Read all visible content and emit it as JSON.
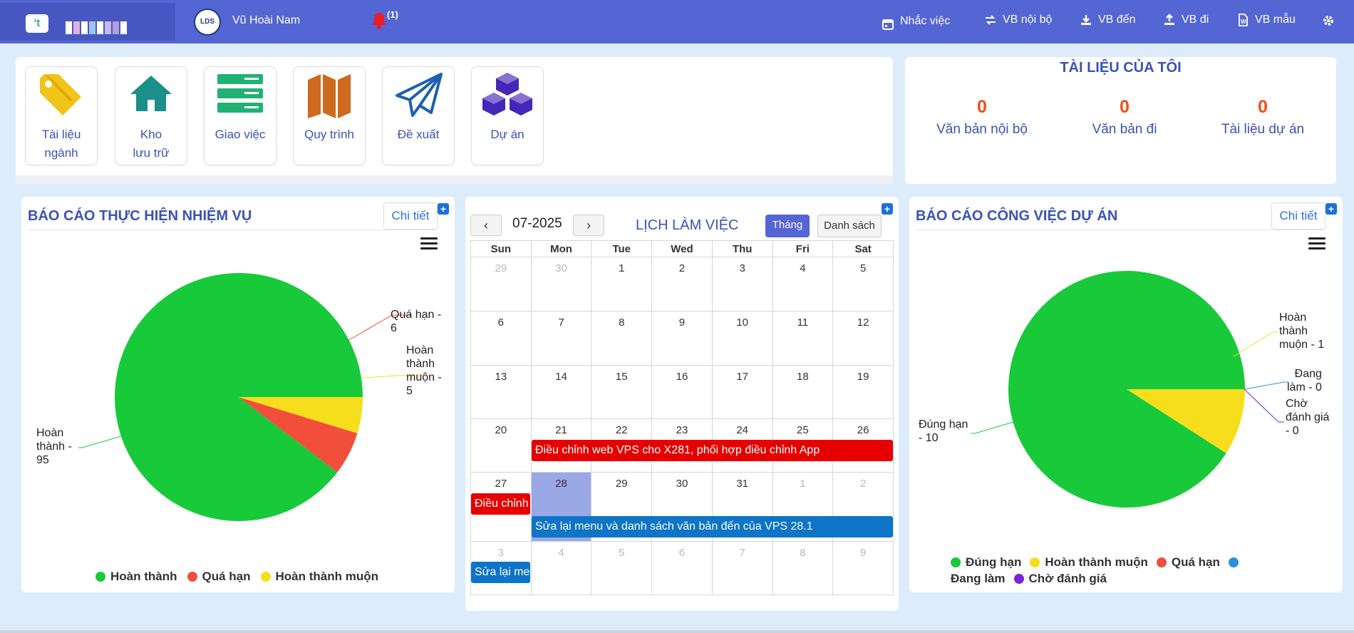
{
  "header": {
    "username": "Vũ Hoài Nam",
    "notification_count": "(1)",
    "nav": [
      {
        "label": "Nhắc việc",
        "icon": "calendar-icon"
      },
      {
        "label": "VB nội bộ",
        "icon": "exchange-icon"
      },
      {
        "label": "VB đến",
        "icon": "download-icon"
      },
      {
        "label": "VB đi",
        "icon": "upload-icon"
      },
      {
        "label": "VB mẫu",
        "icon": "word-file-icon"
      }
    ]
  },
  "tiles": [
    {
      "label": "Tài liệu\nngành",
      "icon": "tag-icon",
      "color": "#f0c419"
    },
    {
      "label": "Kho\nlưu trữ",
      "icon": "home-icon",
      "color": "#1b8f8a"
    },
    {
      "label": "Giao việc",
      "icon": "server-list-icon",
      "color": "#20b173"
    },
    {
      "label": "Quy trình",
      "icon": "map-icon",
      "color": "#cd6a1f"
    },
    {
      "label": "Đề xuất",
      "icon": "paper-plane-icon",
      "color": "#1e5fb0"
    },
    {
      "label": "Dự án",
      "icon": "cubes-icon",
      "color": "#4427b8"
    }
  ],
  "my_documents": {
    "title": "TÀI LIỆU CỦA TÔI",
    "stats": [
      {
        "count": "0",
        "label": "Văn bản nội bộ"
      },
      {
        "count": "0",
        "label": "Văn bản đi"
      },
      {
        "count": "0",
        "label": "Tài liệu dự án"
      }
    ]
  },
  "task_report": {
    "title": "BÁO CÁO THỰC HIỆN NHIỆM VỤ",
    "detail_label": "Chi tiết",
    "slice_labels": [
      "Quá hạn -\n6",
      "Hoàn\nthành\nmuộn -\n5",
      "Hoàn\nthành -\n95"
    ],
    "legend": [
      "Hoàn thành",
      "Quá hạn",
      "Hoàn thành muộn"
    ]
  },
  "calendar": {
    "title": "LỊCH LÀM VIỆC",
    "month_label": "07-2025",
    "prev": "‹",
    "next": "›",
    "view_month": "Tháng",
    "view_list": "Danh sách",
    "weekdays": [
      "Sun",
      "Mon",
      "Tue",
      "Wed",
      "Thu",
      "Fri",
      "Sat"
    ],
    "weeks": [
      [
        "29",
        "30",
        "1",
        "2",
        "3",
        "4",
        "5"
      ],
      [
        "6",
        "7",
        "8",
        "9",
        "10",
        "11",
        "12"
      ],
      [
        "13",
        "14",
        "15",
        "16",
        "17",
        "18",
        "19"
      ],
      [
        "20",
        "21",
        "22",
        "23",
        "24",
        "25",
        "26"
      ],
      [
        "27",
        "28",
        "29",
        "30",
        "31",
        "1",
        "2"
      ],
      [
        "3",
        "4",
        "5",
        "6",
        "7",
        "8",
        "9"
      ]
    ],
    "events": [
      {
        "title": "Điều chỉnh web VPS cho X281, phối hợp điều chỉnh App",
        "color": "#e60000"
      },
      {
        "title": "Điều chỉnh web VPS cho X281, phối hợp điều chỉnh App",
        "color": "#e60000"
      },
      {
        "title": "Sửa lại menu và danh sách văn bản đến của VPS 28.1",
        "color": "#0d74c8"
      },
      {
        "title": "Sửa lại menu và danh sách văn bản đến của VPS 28.1",
        "color": "#0d74c8"
      }
    ]
  },
  "project_report": {
    "title": "BÁO CÁO CÔNG VIỆC DỰ ÁN",
    "detail_label": "Chi tiết",
    "slice_labels": [
      "Hoàn\nthành\nmuộn - 1",
      "Đang\nlàm - 0",
      "Chờ\nđánh giá\n- 0",
      "Đúng hạn\n- 10"
    ],
    "legend": [
      "Đúng hạn",
      "Hoàn thành muộn",
      "Quá hạn",
      "Đang làm",
      "Chờ đánh giá"
    ]
  },
  "chart_data": [
    {
      "type": "pie",
      "title": "BÁO CÁO THỰC HIỆN NHIỆM VỤ",
      "series": [
        {
          "name": "",
          "values": [
            95,
            6,
            5
          ]
        }
      ],
      "categories": [
        "Hoàn thành",
        "Quá hạn",
        "Hoàn thành muộn"
      ],
      "colors": [
        "#18c93a",
        "#f14f3c",
        "#f7de1c"
      ],
      "legend": "bottom"
    },
    {
      "type": "pie",
      "title": "BÁO CÁO CÔNG VIỆC DỰ ÁN",
      "series": [
        {
          "name": "",
          "values": [
            10,
            1,
            0,
            0,
            0
          ]
        }
      ],
      "categories": [
        "Đúng hạn",
        "Hoàn thành muộn",
        "Quá hạn",
        "Đang làm",
        "Chờ đánh giá"
      ],
      "colors": [
        "#18c93a",
        "#f7de1c",
        "#f14f3c",
        "#2a8fe0",
        "#7b22d8"
      ],
      "legend": "bottom"
    }
  ]
}
